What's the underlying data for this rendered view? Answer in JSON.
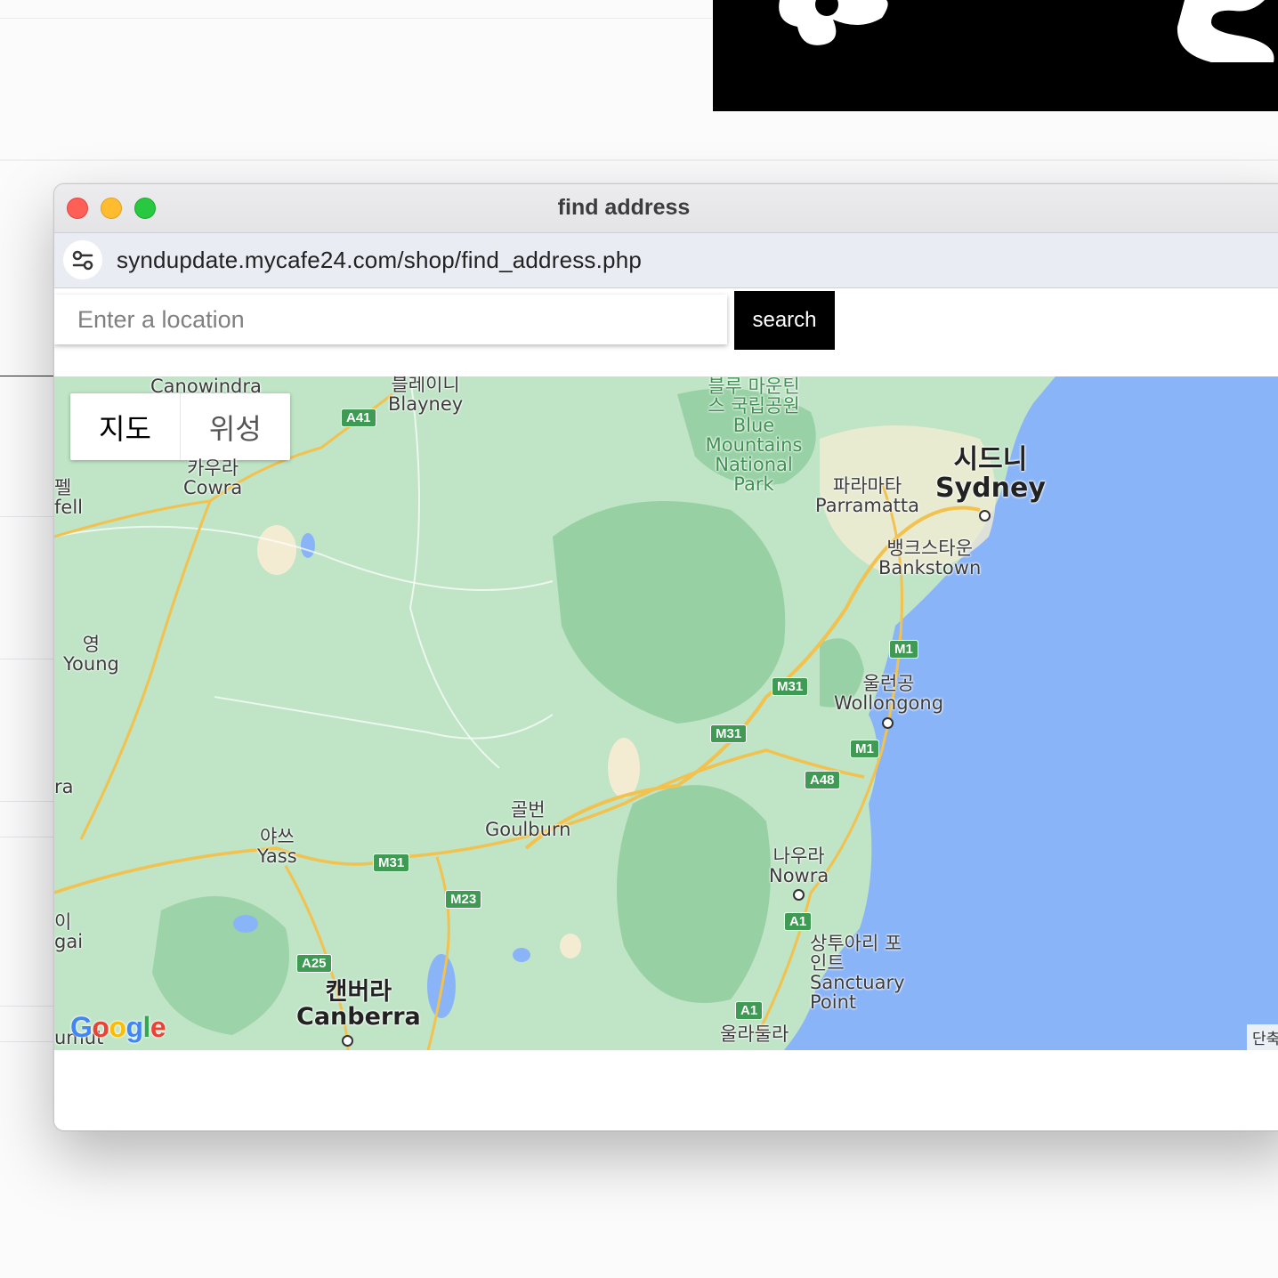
{
  "window": {
    "title": "find address",
    "url": "syndupdate.mycafe24.com/shop/find_address.php"
  },
  "search": {
    "placeholder": "Enter a location",
    "value": "",
    "button_label": "search"
  },
  "map": {
    "type_options": {
      "map": "지도",
      "satellite": "위성"
    },
    "selected_type": "지도",
    "logo": "Google",
    "terms_fragment": "단축",
    "cities": {
      "canowindra": {
        "en": "Canowindra"
      },
      "blayney": {
        "ko": "블레이니",
        "en": "Blayney"
      },
      "cowra": {
        "ko": "카우라",
        "en": "Cowra"
      },
      "blue_mountains": {
        "ko": "블루 마운틴 스 국립공원",
        "en": "Blue Mountains National Park"
      },
      "sydney": {
        "ko": "시드니",
        "en": "Sydney"
      },
      "parramatta": {
        "ko": "파라마타",
        "en": "Parramatta"
      },
      "bankstown": {
        "ko": "뱅크스타운",
        "en": "Bankstown"
      },
      "young": {
        "ko": "영",
        "en": "Young"
      },
      "wollongong": {
        "ko": "울런공",
        "en": "Wollongong"
      },
      "goulburn": {
        "ko": "골번",
        "en": "Goulburn"
      },
      "yass": {
        "ko": "야쓰",
        "en": "Yass"
      },
      "nowra": {
        "ko": "나우라",
        "en": "Nowra"
      },
      "sanctuary_point": {
        "ko": "상투아리 포인트",
        "en": "Sanctuary Point"
      },
      "canberra": {
        "ko": "캔버라",
        "en": "Canberra"
      },
      "ulladulla": {
        "ko": "울라둘라"
      }
    },
    "edge_labels": {
      "l1_ko": "펠",
      "l1_en": "fell",
      "l2": "ra",
      "l3_ko": "이",
      "l3_en": "gai",
      "l4": "umut"
    },
    "roads": [
      "A41",
      "M1",
      "M31",
      "M31",
      "M1",
      "A48",
      "M31",
      "M23",
      "A1",
      "A25",
      "A1"
    ]
  },
  "colors": {
    "map_land": "#bfe4c6",
    "map_forest": "#8fcc9c",
    "map_water": "#8ab4f8",
    "road": "#f2c14e",
    "search_button": "#000000"
  }
}
